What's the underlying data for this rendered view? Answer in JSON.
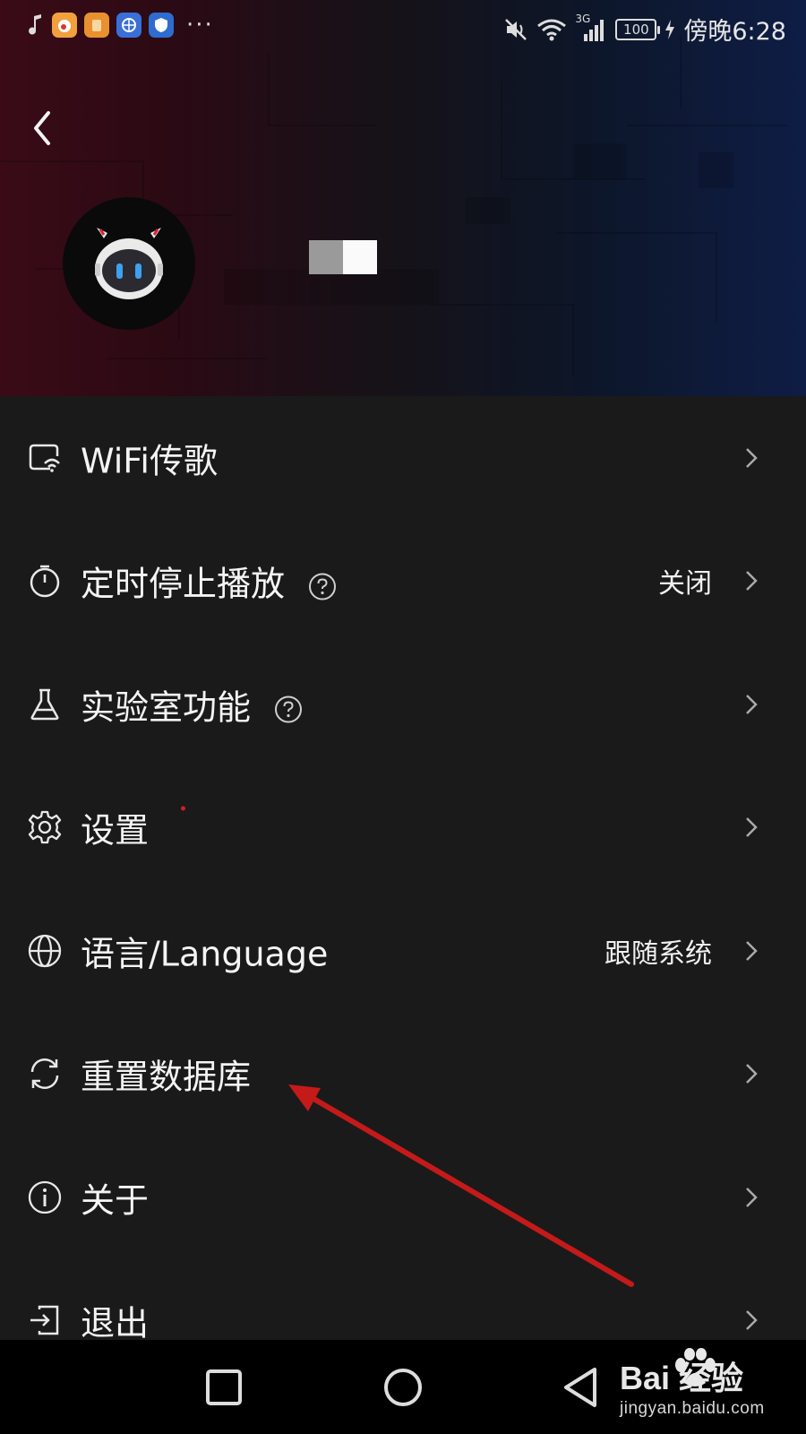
{
  "status_bar": {
    "battery": "100",
    "network": "3G",
    "time": "傍晚6:28"
  },
  "menu": [
    {
      "label": "WiFi传歌",
      "icon": "wifi-transfer-icon",
      "value": "",
      "help": false
    },
    {
      "label": "定时停止播放",
      "icon": "timer-icon",
      "value": "关闭",
      "help": true
    },
    {
      "label": "实验室功能",
      "icon": "flask-icon",
      "value": "",
      "help": true
    },
    {
      "label": "设置",
      "icon": "gear-icon",
      "value": "",
      "help": false
    },
    {
      "label": "语言/Language",
      "icon": "globe-icon",
      "value": "跟随系统",
      "help": false
    },
    {
      "label": "重置数据库",
      "icon": "refresh-icon",
      "value": "",
      "help": false
    },
    {
      "label": "关于",
      "icon": "info-icon",
      "value": "",
      "help": false
    },
    {
      "label": "退出",
      "icon": "logout-icon",
      "value": "",
      "help": false
    }
  ],
  "watermark": {
    "brand": "Bai  经验",
    "url": "jingyan.baidu.com"
  },
  "colors": {
    "background": "#1a1a1a",
    "annotation_arrow": "#c41a1a"
  }
}
